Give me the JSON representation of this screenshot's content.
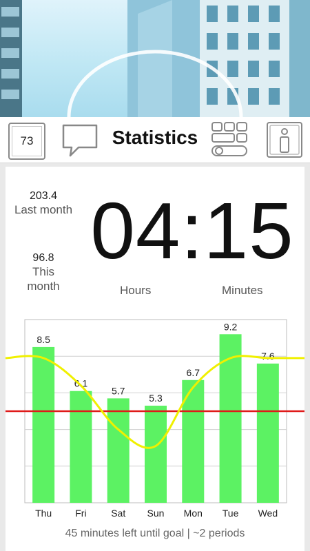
{
  "header": {
    "day_number": "73",
    "title": "Statistics",
    "comment_icon": "speech-bubble-icon",
    "widgets_icon": "dashboard-widgets-icon",
    "info_icon": "info-icon"
  },
  "stats": {
    "last_month_value": "203.4",
    "last_month_label": "Last month",
    "this_month_value": "96.8",
    "this_month_label": "This month"
  },
  "timer": {
    "display": "04:15",
    "hours_label": "Hours",
    "minutes_label": "Minutes"
  },
  "footer": {
    "text": "45 minutes left until goal | ~2 periods"
  },
  "colors": {
    "bar": "#5cf263",
    "trend_line": "#f0f000",
    "goal_line": "#e01a1a",
    "grid": "#cfcfcf"
  },
  "chart_data": {
    "type": "bar",
    "categories": [
      "Thu",
      "Fri",
      "Sat",
      "Sun",
      "Mon",
      "Tue",
      "Wed"
    ],
    "values": [
      8.5,
      6.1,
      5.7,
      5.3,
      6.7,
      9.2,
      7.6
    ],
    "data_labels": [
      "8.5",
      "6.1",
      "5.7",
      "5.3",
      "6.7",
      "9.2",
      "7.6"
    ],
    "trend_values": [
      7.9,
      6.4,
      4.0,
      3.1,
      6.3,
      7.9,
      7.9
    ],
    "goal_value": 5.0,
    "ylim": [
      0,
      10
    ],
    "grid": true
  }
}
